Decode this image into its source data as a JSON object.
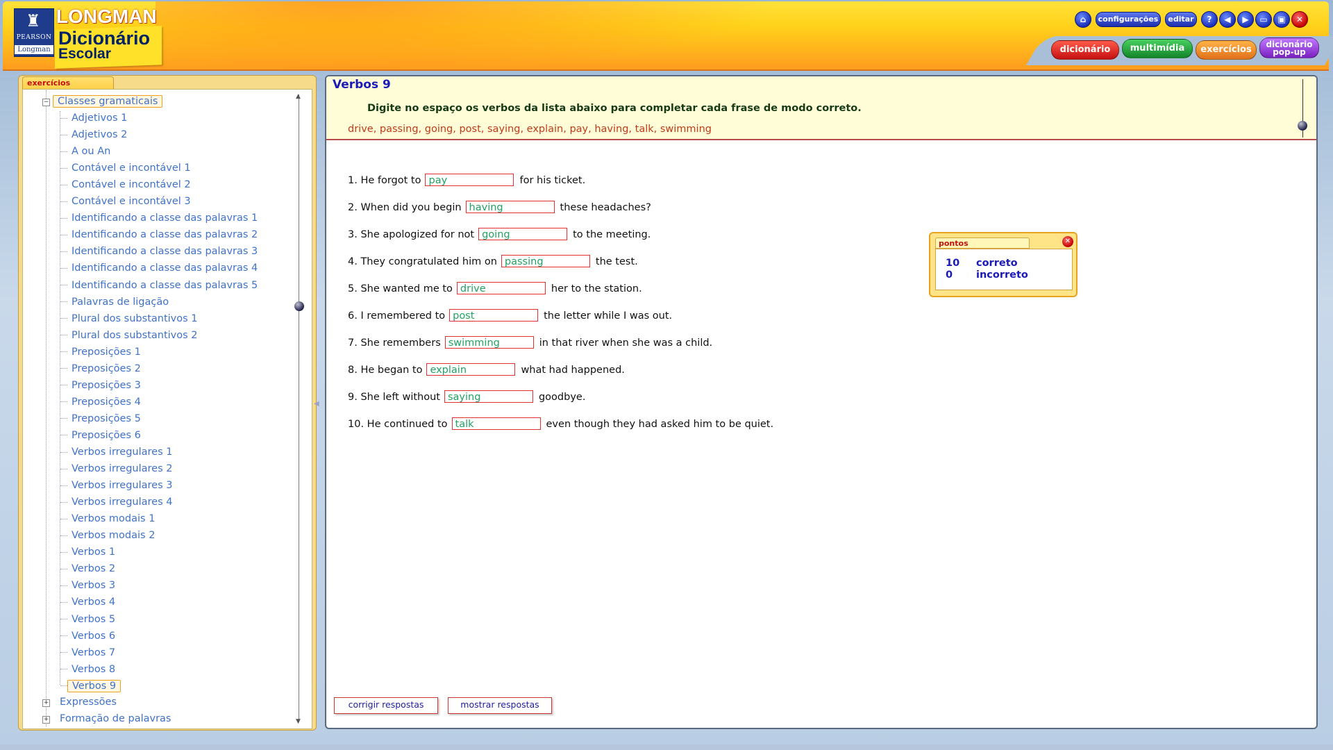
{
  "header": {
    "brand_pearson": "PEARSON",
    "brand_longman_small": "Longman",
    "logo_top": "LONGMAN",
    "logo_mid": "Dicionário",
    "logo_bottom": "Escolar",
    "top_buttons": {
      "settings": "configurações",
      "edit": "editar",
      "help": "?"
    },
    "nav_tabs": [
      {
        "label": "dicionário",
        "color": "#d81e1e"
      },
      {
        "label": "multimídia",
        "color": "#1aa33a"
      },
      {
        "label": "exercícios",
        "color": "#f08a1a"
      },
      {
        "label": "dicionário pop-up",
        "color": "#8a2fd0"
      }
    ]
  },
  "sidebar": {
    "tab_label": "exercícios",
    "root": "Classes gramaticais",
    "items": [
      "Adjetivos 1",
      "Adjetivos 2",
      "A ou An",
      "Contável e incontável 1",
      "Contável e incontável 2",
      "Contável e incontável 3",
      "Identificando a classe das palavras 1",
      "Identificando a classe das palavras 2",
      "Identificando a classe das palavras 3",
      "Identificando a classe das palavras 4",
      "Identificando a classe das palavras 5",
      "Palavras de ligação",
      "Plural dos substantivos 1",
      "Plural dos substantivos 2",
      "Preposições 1",
      "Preposições 2",
      "Preposições 3",
      "Preposições 4",
      "Preposições 5",
      "Preposições 6",
      "Verbos irregulares 1",
      "Verbos irregulares 2",
      "Verbos irregulares 3",
      "Verbos irregulares 4",
      "Verbos modais 1",
      "Verbos modais 2",
      "Verbos 1",
      "Verbos 2",
      "Verbos 3",
      "Verbos 4",
      "Verbos 5",
      "Verbos 6",
      "Verbos 7",
      "Verbos 8",
      "Verbos 9"
    ],
    "selected": "Verbos 9",
    "other_folders": [
      "Expressões",
      "Formação de palavras"
    ]
  },
  "exercise": {
    "title": "Verbos 9",
    "instruction": "Digite no espaço os verbos da lista abaixo para completar cada frase de modo correto.",
    "word_list": "drive, passing, going, post, saying, explain, pay, having, talk, swimming",
    "questions": [
      {
        "before": "1. He forgot to",
        "answer": "pay",
        "after": "for his ticket."
      },
      {
        "before": "2. When did you begin",
        "answer": "having",
        "after": "these headaches?"
      },
      {
        "before": "3. She apologized for not",
        "answer": "going",
        "after": "to the meeting."
      },
      {
        "before": "4. They congratulated him on",
        "answer": "passing",
        "after": "the test."
      },
      {
        "before": "5. She wanted me to",
        "answer": "drive",
        "after": "her to the station."
      },
      {
        "before": "6. I remembered to",
        "answer": "post",
        "after": "the letter while I was out."
      },
      {
        "before": "7. She remembers",
        "answer": "swimming",
        "after": "in that river when she was a child."
      },
      {
        "before": "8. He began to",
        "answer": "explain",
        "after": "what had happened."
      },
      {
        "before": "9. She left without",
        "answer": "saying",
        "after": "goodbye."
      },
      {
        "before": "10. He continued to",
        "answer": "talk",
        "after": "even though they had asked him to be quiet."
      }
    ],
    "buttons": {
      "check": "corrigir respostas",
      "show": "mostrar respostas"
    }
  },
  "score": {
    "tab_label": "pontos",
    "correct_count": "10",
    "correct_label": "correto",
    "incorrect_count": "0",
    "incorrect_label": "incorreto"
  }
}
